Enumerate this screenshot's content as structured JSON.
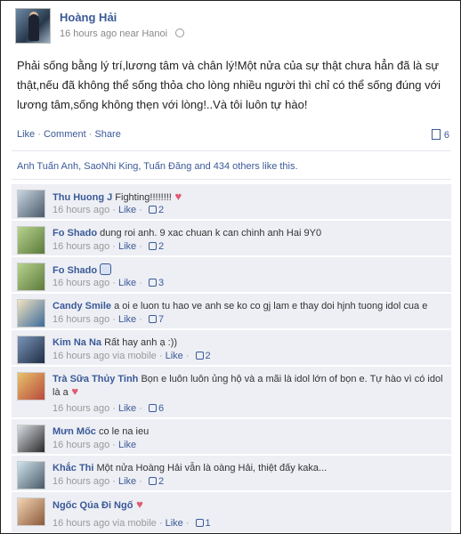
{
  "post": {
    "author": "Hoàng Hải",
    "meta": "16 hours ago near Hanoi",
    "text": "Phải sống bằng lý trí,lương tâm và chân lý!Một nửa của sự thật chưa hẳn đã là sự thật,nếu đã không thể sống thỏa cho lòng nhiều người thì chỉ có thể sống đúng với lương tâm,sống không thẹn với lòng!..Và tôi luôn tự hào!",
    "action_like": "Like",
    "action_comment": "Comment",
    "action_share": "Share",
    "comments_count": "6",
    "likes_summary": "Anh Tuấn Anh, SaoNhi King, Tuấn Đăng and 434 others like this."
  },
  "comments": [
    {
      "name": "Thu Huong J",
      "text": "Fighting!!!!!!!!",
      "time": "16 hours ago",
      "like": "Like",
      "likes": "2",
      "decor": "heart"
    },
    {
      "name": "Fo Shado",
      "text": "dung roi anh. 9 xac chuan k can chinh anh Hai 9Y0",
      "time": "16 hours ago",
      "like": "Like",
      "likes": "2",
      "decor": ""
    },
    {
      "name": "Fo Shado",
      "text": "",
      "time": "16 hours ago",
      "like": "Like",
      "likes": "3",
      "decor": "thumb"
    },
    {
      "name": "Candy Smile",
      "text": "a oi e luon tu hao ve anh se ko co gj lam e thay doi hjnh tuong idol cua e",
      "time": "16 hours ago",
      "like": "Like",
      "likes": "7",
      "decor": ""
    },
    {
      "name": "Kim Na Na",
      "text": "Rất hay anh ạ :))",
      "time": "16 hours ago via mobile",
      "like": "Like",
      "likes": "2",
      "decor": ""
    },
    {
      "name": "Trà Sữa Thủy Tinh",
      "text": "Bọn e luôn luôn ủng hộ và a mãi là idol lớn of bọn e. Tự hào vì có idol là a",
      "time": "16 hours ago",
      "like": "Like",
      "likes": "6",
      "decor": "heart"
    },
    {
      "name": "Mưn Mốc",
      "text": "co le na ieu",
      "time": "16 hours ago",
      "like": "Like",
      "likes": "",
      "decor": ""
    },
    {
      "name": "Khắc Thi",
      "text": "Một nửa Hoàng Hải vẫn là oàng Hải, thiệt đấy kaka...",
      "time": "16 hours ago",
      "like": "Like",
      "likes": "2",
      "decor": ""
    },
    {
      "name": "Ngốc Qúa Đi Ngố",
      "text": "",
      "time": "16 hours ago via mobile",
      "like": "Like",
      "likes": "1",
      "decor": "heart"
    }
  ]
}
